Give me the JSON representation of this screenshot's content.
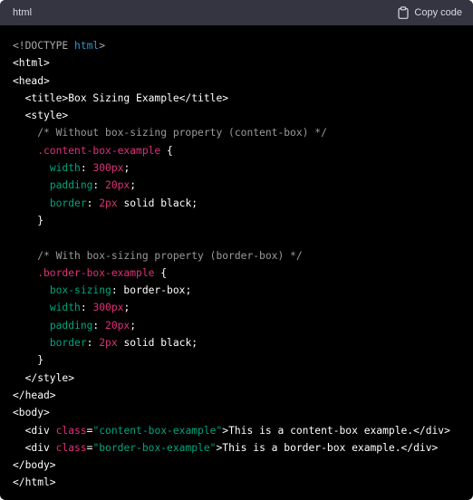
{
  "header": {
    "language": "html",
    "copy_label": "Copy code",
    "icon": "clipboard-icon"
  },
  "colors": {
    "background": "#000000",
    "header_bg": "#343541",
    "keyword": "#2e95d3",
    "selector": "#df3079",
    "property": "#00a67d",
    "comment": "#9a9a9a"
  },
  "code_lines": [
    [
      {
        "t": "<!DOCTYPE ",
        "c": "doctype"
      },
      {
        "t": "html",
        "c": "keyword"
      },
      {
        "t": ">",
        "c": "doctype"
      }
    ],
    [
      {
        "t": "<html>",
        "c": "punct"
      }
    ],
    [
      {
        "t": "<head>",
        "c": "punct"
      }
    ],
    [
      {
        "t": "  <title>Box Sizing Example</title>",
        "c": "punct"
      }
    ],
    [
      {
        "t": "  <style>",
        "c": "punct"
      }
    ],
    [
      {
        "t": "    /* Without box-sizing property (content-box) */",
        "c": "comment"
      }
    ],
    [
      {
        "t": "    .content-box-example",
        "c": "selector"
      },
      {
        "t": " {",
        "c": "punct"
      }
    ],
    [
      {
        "t": "      ",
        "c": "punct"
      },
      {
        "t": "width",
        "c": "prop"
      },
      {
        "t": ": ",
        "c": "punct"
      },
      {
        "t": "300px",
        "c": "num"
      },
      {
        "t": ";",
        "c": "punct"
      }
    ],
    [
      {
        "t": "      ",
        "c": "punct"
      },
      {
        "t": "padding",
        "c": "prop"
      },
      {
        "t": ": ",
        "c": "punct"
      },
      {
        "t": "20px",
        "c": "num"
      },
      {
        "t": ";",
        "c": "punct"
      }
    ],
    [
      {
        "t": "      ",
        "c": "punct"
      },
      {
        "t": "border",
        "c": "prop"
      },
      {
        "t": ": ",
        "c": "punct"
      },
      {
        "t": "2px",
        "c": "num"
      },
      {
        "t": " solid black;",
        "c": "punct"
      }
    ],
    [
      {
        "t": "    }",
        "c": "punct"
      }
    ],
    [
      {
        "t": "",
        "c": "punct"
      }
    ],
    [
      {
        "t": "    /* With box-sizing property (border-box) */",
        "c": "comment"
      }
    ],
    [
      {
        "t": "    .border-box-example",
        "c": "selector"
      },
      {
        "t": " {",
        "c": "punct"
      }
    ],
    [
      {
        "t": "      ",
        "c": "punct"
      },
      {
        "t": "box-sizing",
        "c": "prop"
      },
      {
        "t": ": border-box;",
        "c": "punct"
      }
    ],
    [
      {
        "t": "      ",
        "c": "punct"
      },
      {
        "t": "width",
        "c": "prop"
      },
      {
        "t": ": ",
        "c": "punct"
      },
      {
        "t": "300px",
        "c": "num"
      },
      {
        "t": ";",
        "c": "punct"
      }
    ],
    [
      {
        "t": "      ",
        "c": "punct"
      },
      {
        "t": "padding",
        "c": "prop"
      },
      {
        "t": ": ",
        "c": "punct"
      },
      {
        "t": "20px",
        "c": "num"
      },
      {
        "t": ";",
        "c": "punct"
      }
    ],
    [
      {
        "t": "      ",
        "c": "punct"
      },
      {
        "t": "border",
        "c": "prop"
      },
      {
        "t": ": ",
        "c": "punct"
      },
      {
        "t": "2px",
        "c": "num"
      },
      {
        "t": " solid black;",
        "c": "punct"
      }
    ],
    [
      {
        "t": "    }",
        "c": "punct"
      }
    ],
    [
      {
        "t": "  </style>",
        "c": "punct"
      }
    ],
    [
      {
        "t": "</head>",
        "c": "punct"
      }
    ],
    [
      {
        "t": "<body>",
        "c": "punct"
      }
    ],
    [
      {
        "t": "  <div ",
        "c": "punct"
      },
      {
        "t": "class",
        "c": "attr"
      },
      {
        "t": "=",
        "c": "punct"
      },
      {
        "t": "\"content-box-example\"",
        "c": "str"
      },
      {
        "t": ">This is a content-box example.</div>",
        "c": "punct"
      }
    ],
    [
      {
        "t": "  <div ",
        "c": "punct"
      },
      {
        "t": "class",
        "c": "attr"
      },
      {
        "t": "=",
        "c": "punct"
      },
      {
        "t": "\"border-box-example\"",
        "c": "str"
      },
      {
        "t": ">This is a border-box example.</div>",
        "c": "punct"
      }
    ],
    [
      {
        "t": "</body>",
        "c": "punct"
      }
    ],
    [
      {
        "t": "</html>",
        "c": "punct"
      }
    ]
  ]
}
